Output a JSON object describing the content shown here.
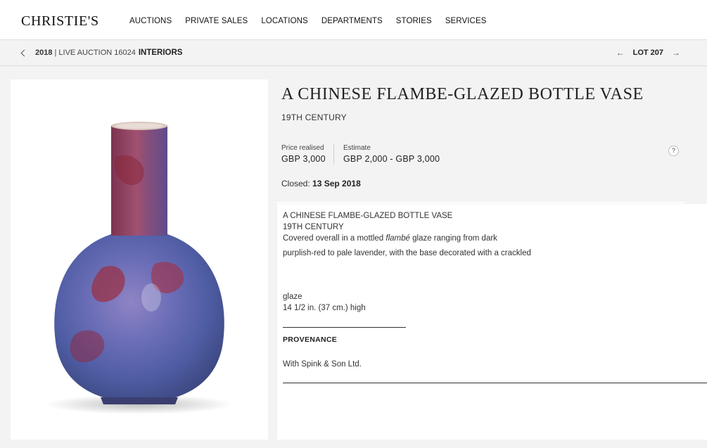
{
  "header": {
    "logo": "CHRISTIE'S",
    "nav": [
      "AUCTIONS",
      "PRIVATE SALES",
      "LOCATIONS",
      "DEPARTMENTS",
      "STORIES",
      "SERVICES"
    ]
  },
  "breadcrumb": {
    "year": "2018",
    "sale": "| LIVE AUCTION 16024",
    "title": "INTERIORS",
    "lot": "LOT 207"
  },
  "lot": {
    "title": "A CHINESE FLAMBE-GLAZED BOTTLE VASE",
    "subtitle": "19TH CENTURY",
    "price_label": "Price realised",
    "price_value": "GBP 3,000",
    "estimate_label": "Estimate",
    "estimate_value": "GBP 2,000 - GBP 3,000",
    "help": "?",
    "closed_label": "Closed:",
    "closed_date": "13 Sep 2018"
  },
  "description": {
    "line1": "A CHINESE FLAMBE-GLAZED BOTTLE VASE",
    "line2": "19TH CENTURY",
    "line3_pre": "Covered overall in a mottled ",
    "line3_em": "flambé",
    "line3_post": " glaze ranging from dark",
    "line4": "purplish-red to pale lavender, with the base decorated with a crackled",
    "line5": "glaze",
    "line6": "14 1/2 in. (37 cm.) high",
    "provenance_heading": "PROVENANCE",
    "provenance_text": "With Spink & Son Ltd."
  },
  "colors": {
    "background": "#f3f3f3",
    "panel": "#ffffff",
    "vase_blue": "#5b63a8",
    "vase_red": "#9b2e3f"
  },
  "icons": [
    "chevron-left-icon",
    "arrow-left-icon",
    "arrow-right-icon",
    "help-icon"
  ]
}
